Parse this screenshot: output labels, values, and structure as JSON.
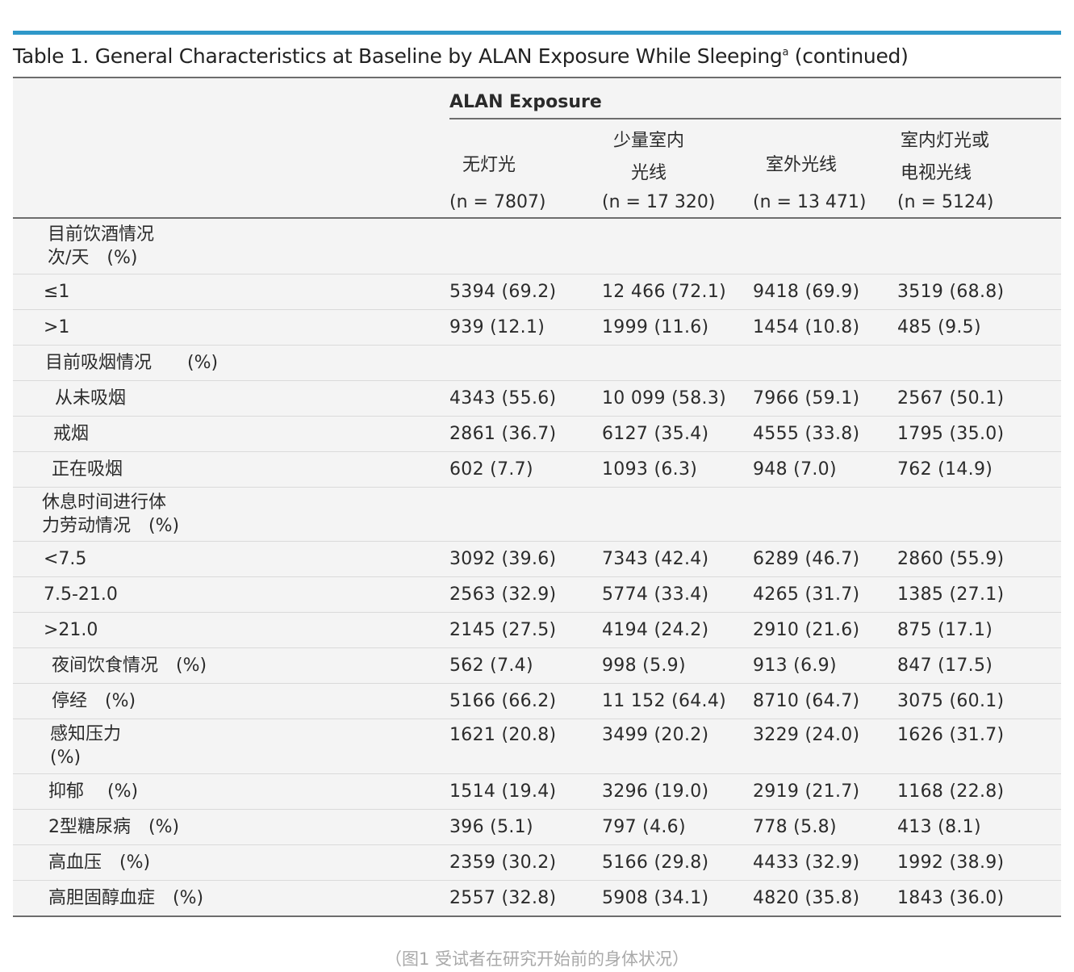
{
  "table": {
    "title": "Table 1. General Characteristics at Baseline by ALAN Exposure While Sleeping",
    "title_sup": "a",
    "title_suffix": " (continued)",
    "group_header": "ALAN Exposure",
    "columns": [
      {
        "name_lines": [
          "无灯光"
        ],
        "n": "(n = 7807)"
      },
      {
        "name_lines": [
          "少量室内",
          "光线"
        ],
        "n": "(n = 17 320)"
      },
      {
        "name_lines": [
          "室外光线"
        ],
        "n": "(n = 13 471)"
      },
      {
        "name_lines": [
          "室内灯光或",
          "电视光线"
        ],
        "n": "(n = 5124)"
      }
    ],
    "rows": [
      {
        "label_lines": [
          "目前饮酒情况",
          "次/天　(%)"
        ],
        "values": []
      },
      {
        "label_lines": [
          "≤1"
        ],
        "values": [
          "5394 (69.2)",
          "12 466 (72.1)",
          "9418 (69.9)",
          "3519 (68.8)"
        ]
      },
      {
        "label_lines": [
          ">1"
        ],
        "values": [
          "939 (12.1)",
          "1999 (11.6)",
          "1454 (10.8)",
          "485 (9.5)"
        ]
      },
      {
        "label_lines": [
          "目前吸烟情况　　(%)"
        ],
        "values": []
      },
      {
        "label_lines": [
          "从未吸烟"
        ],
        "values": [
          "4343 (55.6)",
          "10 099 (58.3)",
          "7966 (59.1)",
          "2567 (50.1)"
        ]
      },
      {
        "label_lines": [
          "戒烟"
        ],
        "values": [
          "2861 (36.7)",
          "6127 (35.4)",
          "4555 (33.8)",
          "1795 (35.0)"
        ]
      },
      {
        "label_lines": [
          "正在吸烟"
        ],
        "values": [
          "602 (7.7)",
          "1093 (6.3)",
          "948 (7.0)",
          "762 (14.9)"
        ]
      },
      {
        "label_lines": [
          "休息时间进行体",
          "力劳动情况　(%)"
        ],
        "values": []
      },
      {
        "label_lines": [
          "<7.5"
        ],
        "values": [
          "3092 (39.6)",
          "7343 (42.4)",
          "6289 (46.7)",
          "2860 (55.9)"
        ]
      },
      {
        "label_lines": [
          "7.5-21.0"
        ],
        "values": [
          "2563 (32.9)",
          "5774 (33.4)",
          "4265 (31.7)",
          "1385 (27.1)"
        ]
      },
      {
        "label_lines": [
          ">21.0"
        ],
        "values": [
          "2145 (27.5)",
          "4194 (24.2)",
          "2910 (21.6)",
          "875 (17.1)"
        ]
      },
      {
        "label_lines": [
          "夜间饮食情况　(%)"
        ],
        "values": [
          "562 (7.4)",
          "998 (5.9)",
          "913 (6.9)",
          "847 (17.5)"
        ]
      },
      {
        "label_lines": [
          "停经　(%)"
        ],
        "values": [
          "5166 (66.2)",
          "11 152 (64.4)",
          "8710 (64.7)",
          "3075 (60.1)"
        ]
      },
      {
        "label_lines": [
          "感知压力",
          "(%)"
        ],
        "values": [
          "1621 (20.8)",
          "3499 (20.2)",
          "3229 (24.0)",
          "1626 (31.7)"
        ]
      },
      {
        "label_lines": [
          "抑郁　 (%)"
        ],
        "values": [
          "1514 (19.4)",
          "3296 (19.0)",
          "2919 (21.7)",
          "1168 (22.8)"
        ]
      },
      {
        "label_lines": [
          "2型糖尿病　(%)"
        ],
        "values": [
          "396 (5.1)",
          "797 (4.6)",
          "778 (5.8)",
          "413 (8.1)"
        ]
      },
      {
        "label_lines": [
          "高血压　(%)"
        ],
        "values": [
          "2359 (30.2)",
          "5166 (29.8)",
          "4433 (32.9)",
          "1992 (38.9)"
        ]
      },
      {
        "label_lines": [
          "高胆固醇血症　(%)"
        ],
        "values": [
          "2557 (32.8)",
          "5908 (34.1)",
          "4820 (35.8)",
          "1843 (36.0)"
        ]
      }
    ]
  },
  "caption": "（图1 受试者在研究开始前的身体状况）"
}
